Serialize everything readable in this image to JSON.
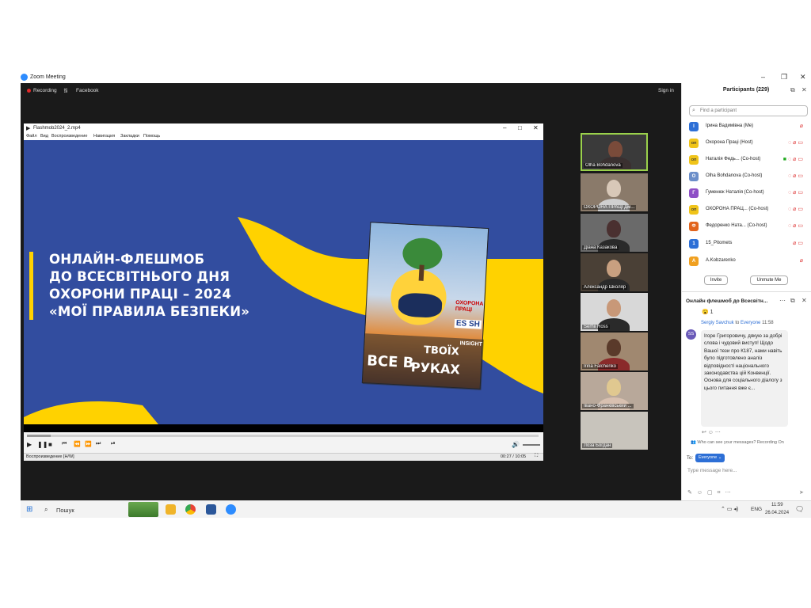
{
  "window": {
    "title": "Zoom Meeting",
    "minimize": "–",
    "maximize": "❐",
    "close": "✕"
  },
  "topbar": {
    "recording": "Recording",
    "facebook": "Facebook",
    "sign_in": "Sign in"
  },
  "player": {
    "title": "Flashmob2024_2.mp4",
    "menu": [
      "Файл",
      "Вид",
      "Воспроизведение",
      "Навигация",
      "Закладки",
      "Помощь"
    ],
    "status_left": "Воспроизведение [H/W]",
    "time": "00:27 / 10:05"
  },
  "slide": {
    "lines": [
      "ОНЛАЙН-ФЛЕШМОБ",
      "ДО ВСЕСВІТНЬОГО ДНЯ",
      "ОХОРОНИ ПРАЦІ – 2024",
      "«МОЇ ПРАВИЛА БЕЗПЕКИ»"
    ],
    "book_title_1": "ВСЕ В",
    "book_title_2": "ТВОЇХ",
    "book_title_3": "РУКАХ",
    "book_brand": "ОХОРОНА ПРАЦІ",
    "book_esosh": "ES SH",
    "book_insight": "INSIGHT"
  },
  "video_tiles": [
    {
      "name": "Olha Bohdanova"
    },
    {
      "name": "ОХОРОНА ПРАЦІ Дм..."
    },
    {
      "name": "Діана Казакова"
    },
    {
      "name": "Александр Школяр"
    },
    {
      "name": "Serhii Ross"
    },
    {
      "name": "Irina Falchenko"
    },
    {
      "name": "Івано-Франківський ..."
    },
    {
      "name": "Лоза Богдан"
    }
  ],
  "participants": {
    "title": "Participants (229)",
    "search_placeholder": "Find a participant",
    "list": [
      {
        "initial": "І",
        "name": "Ірина Вадимівна (Me)",
        "color": "#2d6fd6"
      },
      {
        "initial": "ОП",
        "name": "Охорона Праці (Host)",
        "color": "#f0c419"
      },
      {
        "initial": "ОП",
        "name": "Наталія Федь... (Co-host)",
        "color": "#f0c419"
      },
      {
        "initial": "O",
        "name": "Olha Bohdanova (Co-host)",
        "color": "#6b8ec9"
      },
      {
        "initial": "Г",
        "name": "Гуменюк Наталія (Co-host)",
        "color": "#8e4fc6"
      },
      {
        "initial": "ОП",
        "name": "ОХОРОНА ПРАЦ... (Co-host)",
        "color": "#f0c419"
      },
      {
        "initial": "Ф",
        "name": "Федоренко Ната... (Co-host)",
        "color": "#e2641d"
      },
      {
        "initial": "1",
        "name": "15_Pitomets",
        "color": "#2d6fd6"
      },
      {
        "initial": "A",
        "name": "A.Kobzarenko",
        "color": "#f0a020"
      }
    ],
    "invite": "Invite",
    "unmute": "Unmute Me"
  },
  "chat": {
    "title": "Онлайн флешмоб до Всесвітн...",
    "reaction": "😮 1",
    "sender_initials": "SS",
    "sender": "Sergiy Savchuk",
    "to_label": "to",
    "to": "Everyone",
    "time": "11:58",
    "message": "Ігоре Григоровичу, дякую за добрі слова і чудовий виступ! Щодо Вашої тези про К187, нами навіть було підготовлено аналіз відповідності національного законодавства цій Конвенції. Основа для соціального діалогу з цього питання вже є...",
    "privacy": "Who can see your messages? Recording On",
    "to_prefix": "To:",
    "recipient": "Everyone ⌄",
    "input_placeholder": "Type message here..."
  },
  "taskbar": {
    "search": "Пошук",
    "lang": "ENG",
    "time": "11:59",
    "date": "26.04.2024"
  }
}
